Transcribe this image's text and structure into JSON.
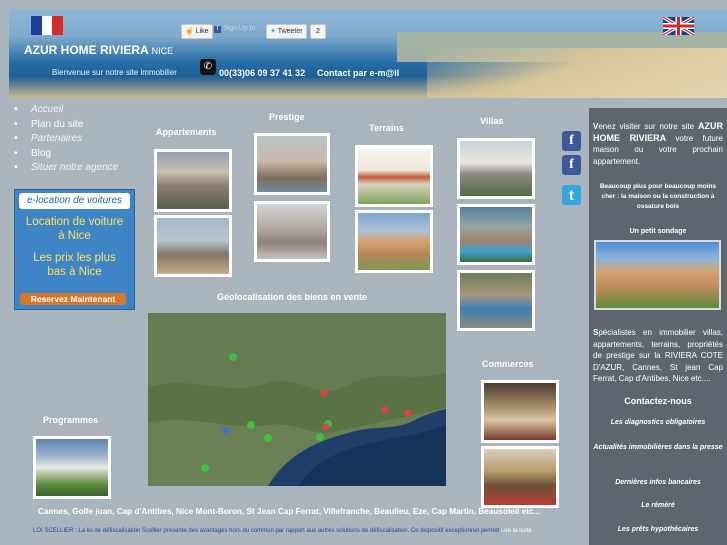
{
  "header": {
    "site_title": "AZUR HOME RIVIERA",
    "site_title_suffix": "NICE",
    "welcome": "Bienvenue sur notre site immobilier",
    "phone": "00(33)06 09 37 41 32",
    "contact": "Contact par e-m@il",
    "like_label": "Like",
    "signup_label": "Sign Up to",
    "tweet_label": "Tweeter",
    "tweet_count": "2"
  },
  "nav": {
    "items": [
      {
        "label": "Accueil"
      },
      {
        "label": "Plan du site"
      },
      {
        "label": "Partenaires"
      },
      {
        "label": "Blog"
      },
      {
        "label": "Situer notre agence"
      }
    ]
  },
  "ad": {
    "logo": "e-location de voitures",
    "line1a": "Location de voiture",
    "line1b": "à Nice",
    "line2a": "Les prix les plus",
    "line2b": "bas à Nice",
    "cta": "Reservez Maintenant"
  },
  "sections": {
    "appartements": "Appartements",
    "prestige": "Prestige",
    "terrains": "Terrains",
    "villas": "Villas",
    "commerces": "Commerces",
    "programmes": "Programmes",
    "geoloc": "Géolocalisation des biens en vente"
  },
  "footer": {
    "towns": "Cannes, Golfe juan, Cap d'Antibes, Nice Mont-Boron, St Jean Cap Ferrat, Villefranche, Beaulieu, Eze, Cap Martin, Beausoleil etc...",
    "loi": "LOI SCELLIER : La loi de défiscalisation Scellier présente des avantages hors du commun par rapport aux autres solutions de défiscalisation. Ce dispositif exceptionnel permet",
    "loi_more": "Lire la suite"
  },
  "right_panel": {
    "intro_prefix": "V",
    "intro_text": "enez visiter sur notre site ",
    "intro_brand": "AZUR HOME RIVIERA",
    "intro_rest": " votre future maison ou votre prochain appartement.",
    "promo": "Beaucoup plus pour beaucoup moins cher : la maison ou la construction à ossature bois",
    "survey": "Un petit sondage",
    "spec_prefix": "S",
    "spec_text": "pécialistes en immobilier villas, appartements, terrains, propriétés de prestige sur la RIVIERA COTE D'AZUR, Cannes, St jean Cap Ferrat, Cap d'Antibes, Nice etc....",
    "contact_heading": "Contactez-nous",
    "links": [
      "Les diagnostics obligatoires",
      "Actualités immobilières dans la presse",
      "Dernières infos bancaires",
      "Le réméré",
      "Les prêts hypothécaires"
    ]
  },
  "colors": {
    "page_bg": "#a9b4bc",
    "panel_bg": "#5d666f",
    "link_blue": "#1f4aa3"
  }
}
